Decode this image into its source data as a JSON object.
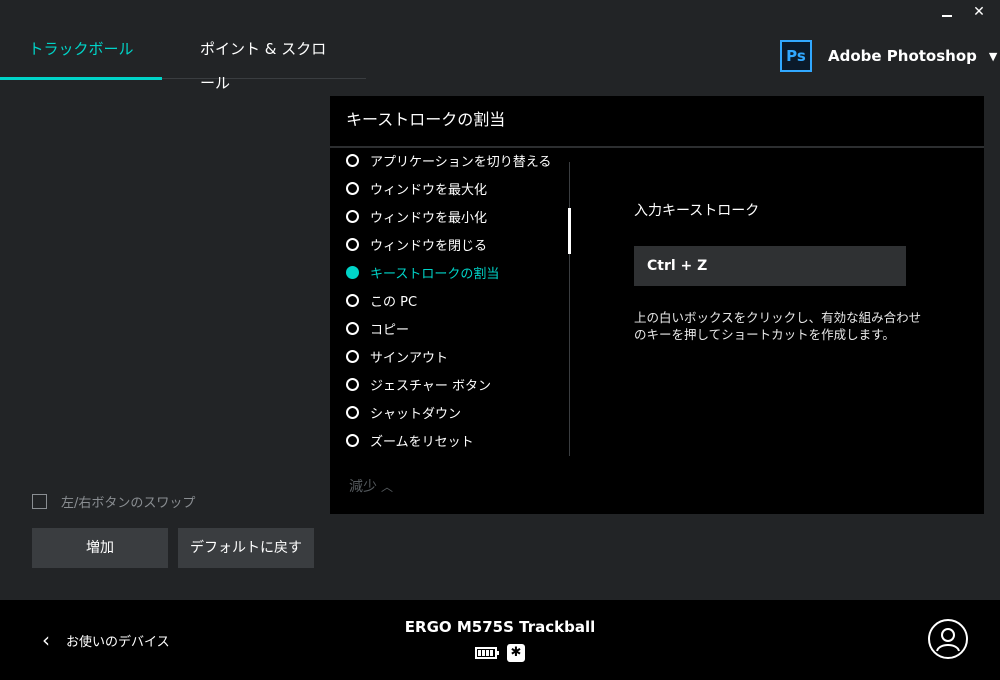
{
  "window": {
    "minimize": "",
    "close": "✕"
  },
  "tabs": [
    {
      "label": "トラックボール",
      "active": true
    },
    {
      "label": "ポイント & スクロール",
      "active": false
    }
  ],
  "app_selector": {
    "icon_text": "Ps",
    "name": "Adobe Photoshop",
    "chevron": "⌄"
  },
  "panel": {
    "title": "キーストロークの割当",
    "actions": [
      {
        "label": "アプリケーションを切り替える",
        "selected": false
      },
      {
        "label": "ウィンドウを最大化",
        "selected": false
      },
      {
        "label": "ウィンドウを最小化",
        "selected": false
      },
      {
        "label": "ウィンドウを閉じる",
        "selected": false
      },
      {
        "label": "キーストロークの割当",
        "selected": true
      },
      {
        "label": "この PC",
        "selected": false
      },
      {
        "label": "コピー",
        "selected": false
      },
      {
        "label": "サインアウト",
        "selected": false
      },
      {
        "label": "ジェスチャー ボタン",
        "selected": false
      },
      {
        "label": "シャットダウン",
        "selected": false
      },
      {
        "label": "ズームをリセット",
        "selected": false
      }
    ],
    "reduce_label": "減少",
    "keystroke_label": "入力キーストローク",
    "keystroke_value": "Ctrl + Z",
    "help_text": "上の白いボックスをクリックし、有効な組み合わせのキーを押してショートカットを作成します。"
  },
  "swap_label": "左/右ボタンのスワップ",
  "buttons": {
    "add": "増加",
    "default": "デフォルトに戻す"
  },
  "footer": {
    "back_label": "お使いのデバイス",
    "device_name": "ERGO M575S Trackball"
  },
  "colors": {
    "accent": "#00d4c8",
    "background": "#222426",
    "panel": "#000000"
  }
}
